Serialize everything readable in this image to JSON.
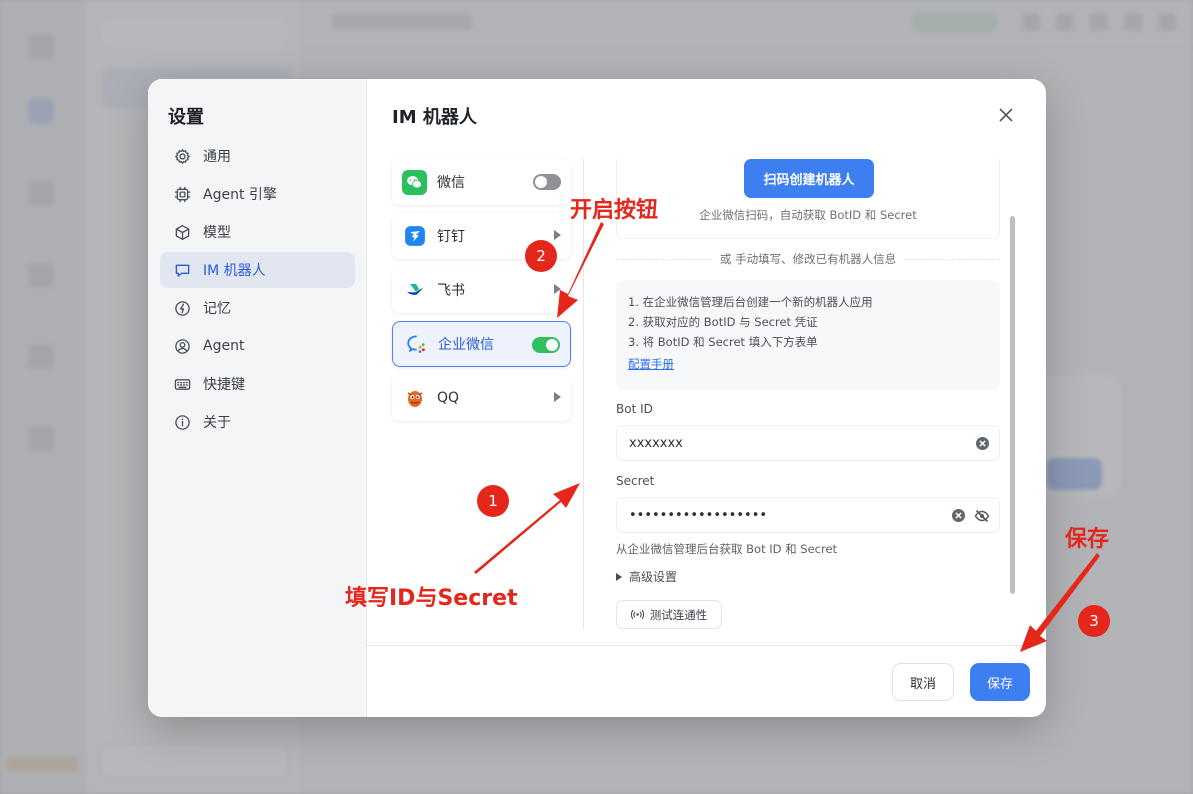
{
  "settings": {
    "title": "设置",
    "nav": [
      {
        "label": "通用",
        "icon": "gear-icon"
      },
      {
        "label": "Agent 引擎",
        "icon": "cpu-icon"
      },
      {
        "label": "模型",
        "icon": "cube-icon"
      },
      {
        "label": "IM 机器人",
        "icon": "chat-bubble-icon",
        "active": true
      },
      {
        "label": "记忆",
        "icon": "bolt-icon"
      },
      {
        "label": "Agent",
        "icon": "user-circle-icon"
      },
      {
        "label": "快捷键",
        "icon": "keyboard-icon"
      },
      {
        "label": "关于",
        "icon": "info-icon"
      }
    ]
  },
  "im": {
    "title": "IM 机器人",
    "platforms": [
      {
        "label": "微信",
        "icon": "wechat-icon",
        "control": "toggle",
        "enabled": false
      },
      {
        "label": "钉钉",
        "icon": "dingtalk-icon",
        "control": "arrow"
      },
      {
        "label": "飞书",
        "icon": "feishu-icon",
        "control": "arrow"
      },
      {
        "label": "企业微信",
        "icon": "wecom-icon",
        "control": "toggle",
        "enabled": true,
        "selected": true
      },
      {
        "label": "QQ",
        "icon": "qq-icon",
        "control": "arrow"
      }
    ],
    "scan_button": "扫码创建机器人",
    "scan_hint": "企业微信扫码，自动获取 BotID 和 Secret",
    "manual_divider": "或 手动填写、修改已有机器人信息",
    "steps": [
      "1. 在企业微信管理后台创建一个新的机器人应用",
      "2. 获取对应的 BotID 与 Secret 凭证",
      "3. 将 BotID 和 Secret 填入下方表单"
    ],
    "manual_link": "配置手册",
    "bot_id_label": "Bot ID",
    "bot_id_value": "xxxxxxx",
    "secret_label": "Secret",
    "secret_value": "••••••••••••••••••",
    "secret_hint": "从企业微信管理后台获取 Bot ID 和 Secret",
    "advanced_label": "高级设置",
    "test_button": "测试连通性",
    "cancel_button": "取消",
    "save_button": "保存"
  },
  "annotations": {
    "toggle_text": "开启按钮",
    "fill_text": "填写ID与Secret",
    "save_text": "保存",
    "badge_1": "1",
    "badge_2": "2",
    "badge_3": "3",
    "color": "#e5261b"
  },
  "colors": {
    "accent": "#3d7ff0",
    "toggle_on": "#2fbf5c",
    "active_nav_bg": "#e1e6f1"
  }
}
